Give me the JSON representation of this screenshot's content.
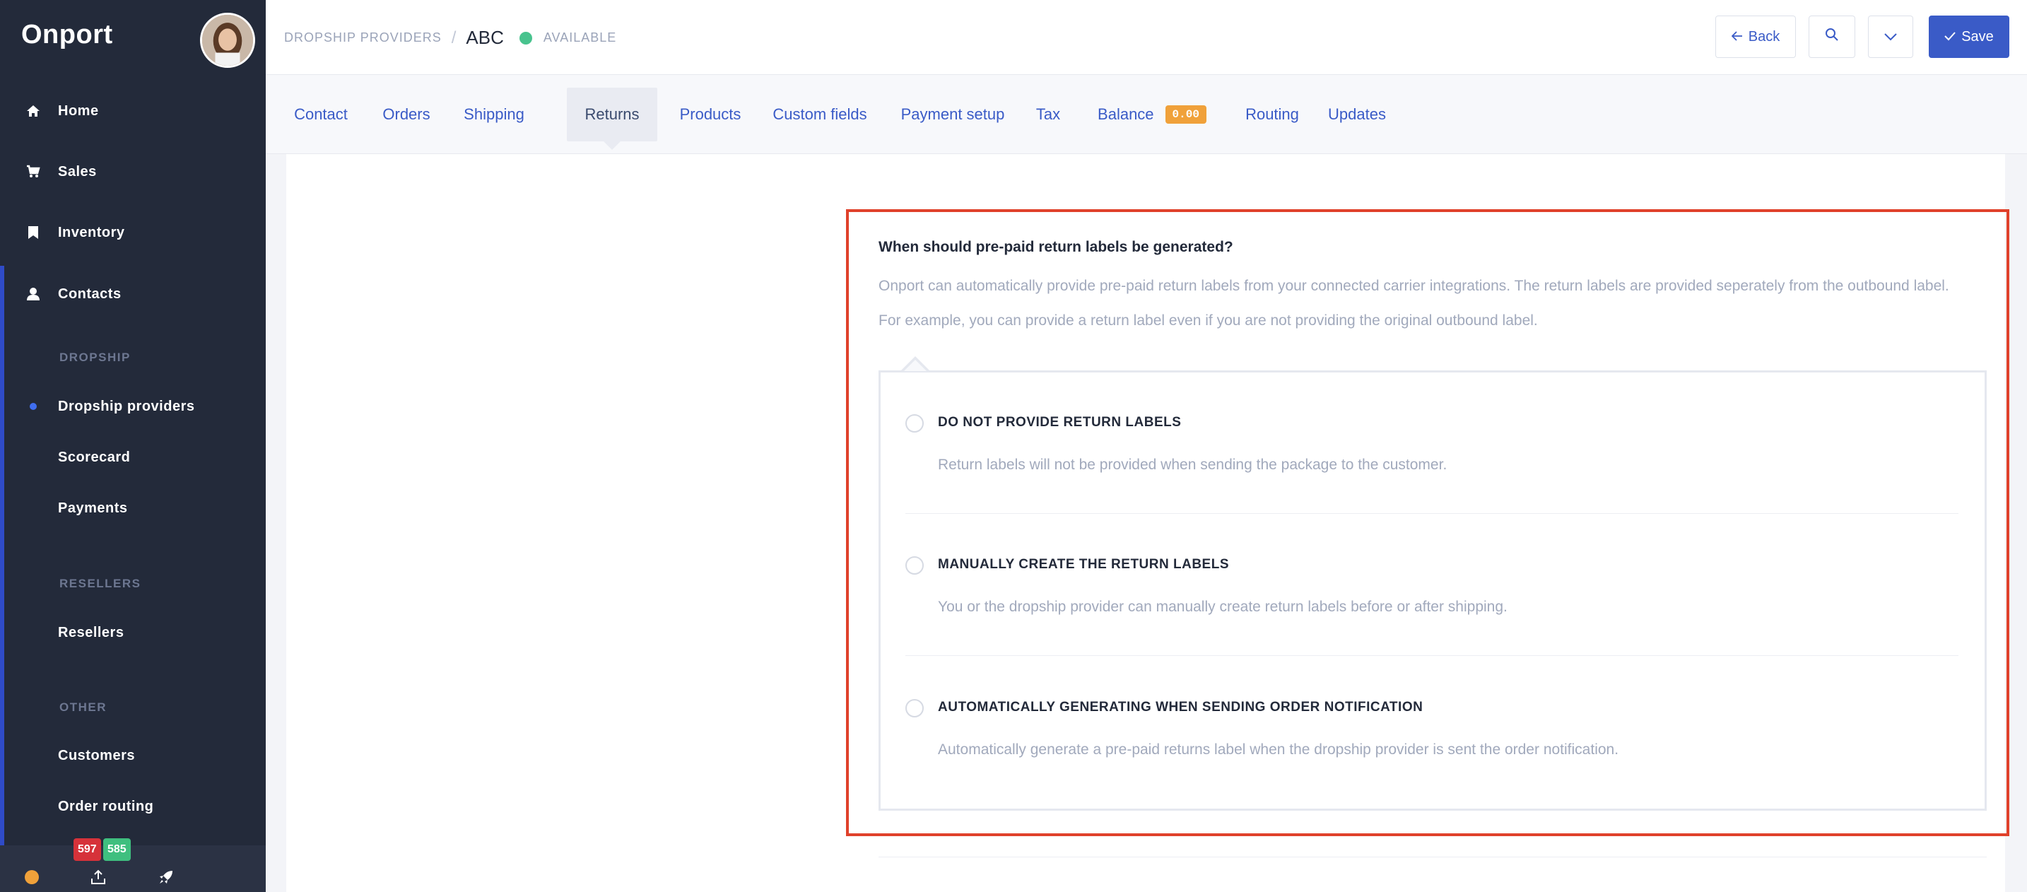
{
  "app": {
    "logo": "Onport"
  },
  "sidebar": {
    "main_items": [
      {
        "label": "Home",
        "icon": "home-icon"
      },
      {
        "label": "Sales",
        "icon": "cart-icon"
      },
      {
        "label": "Inventory",
        "icon": "bookmark-icon"
      },
      {
        "label": "Contacts",
        "icon": "user-icon"
      }
    ],
    "sections": [
      {
        "label": "DROPSHIP",
        "items": [
          "Dropship providers",
          "Scorecard",
          "Payments"
        ]
      },
      {
        "label": "RESELLERS",
        "items": [
          "Resellers"
        ]
      },
      {
        "label": "OTHER",
        "items": [
          "Customers",
          "Order routing"
        ]
      }
    ],
    "badges": {
      "red": "597",
      "green": "585"
    },
    "bottom_icons": [
      "status-dot-icon",
      "upload-icon",
      "rocket-icon"
    ]
  },
  "header": {
    "breadcrumb_parent": "DROPSHIP PROVIDERS",
    "breadcrumb_sep": "/",
    "breadcrumb_current": "ABC",
    "status": "AVAILABLE",
    "back_label": "Back",
    "save_label": "Save"
  },
  "tabs": [
    {
      "label": "Contact"
    },
    {
      "label": "Orders"
    },
    {
      "label": "Shipping"
    },
    {
      "label": "Returns",
      "active": true
    },
    {
      "label": "Products"
    },
    {
      "label": "Custom fields"
    },
    {
      "label": "Payment setup"
    },
    {
      "label": "Tax"
    },
    {
      "label": "Balance",
      "badge": "0.00"
    },
    {
      "label": "Routing"
    },
    {
      "label": "Updates"
    }
  ],
  "returns": {
    "question": "When should pre-paid return labels be generated?",
    "description_line1": "Onport can automatically provide pre-paid return labels from your connected carrier integrations. The return labels are provided seperately from the outbound label.",
    "description_line2": "For example, you can provide a return label even if you are not providing the original outbound label.",
    "options": [
      {
        "title": "DO NOT PROVIDE RETURN LABELS",
        "description": "Return labels will not be provided when sending the package to the customer."
      },
      {
        "title": "MANUALLY CREATE THE RETURN LABELS",
        "description": "You or the dropship provider can manually create return labels before or after shipping."
      },
      {
        "title": "AUTOMATICALLY GENERATING WHEN SENDING ORDER NOTIFICATION",
        "description": "Automatically generate a pre-paid returns label when the dropship provider is sent the order notification."
      }
    ]
  },
  "colors": {
    "sidebar_bg": "#232a3a",
    "accent": "#3a5bc7",
    "status_green": "#48c38e",
    "highlight_red": "#e0412b",
    "balance_badge": "#f0a13a"
  }
}
